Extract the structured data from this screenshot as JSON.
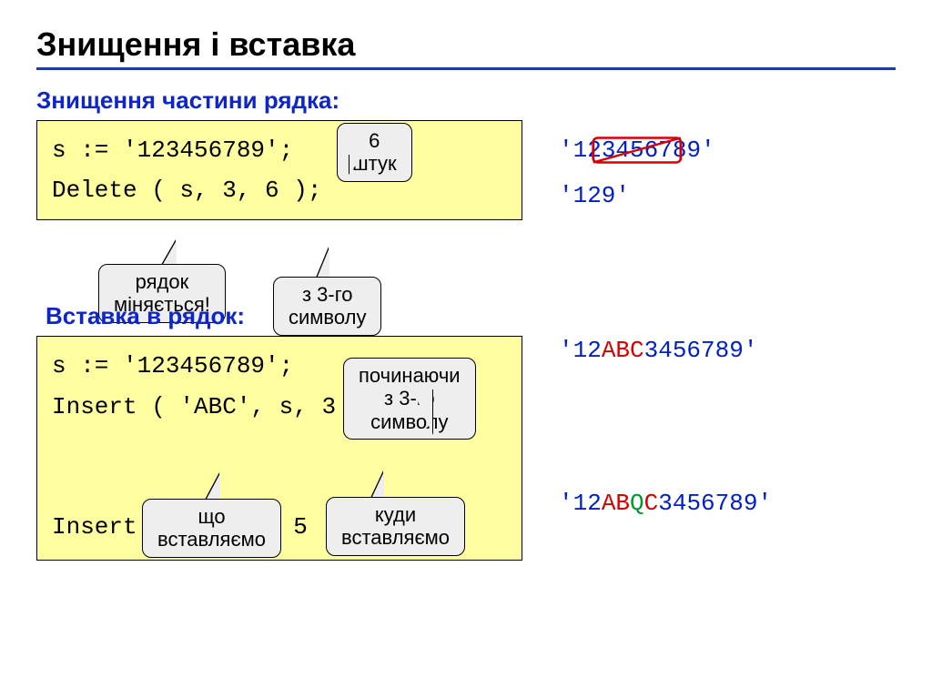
{
  "title": "Знищення і вставка",
  "section1": {
    "label": "Знищення частини рядка:",
    "code": {
      "line1": "s := '123456789';",
      "line2": "Delete ( s, 3, 6 );"
    },
    "callouts": {
      "count": "6 штук",
      "string_changes_l1": "рядок",
      "string_changes_l2": "міняється!",
      "from3": "з 3-го символу"
    },
    "results": {
      "before_pre": "'12",
      "before_mid": "345678",
      "before_post": "9'",
      "after": "'129'"
    }
  },
  "section2": {
    "label": "Вставка в рядок:",
    "code": {
      "line1": "s := '123456789';",
      "line2": "Insert ( 'ABC', s, 3 );",
      "line3": "Insert ( 'Q', s, 5 );"
    },
    "callouts": {
      "starting_from": "починаючи з 3-го символу",
      "what_l1": "що",
      "what_l2": "вставляємо",
      "where_l1": "куди",
      "where_l2": "вставляємо"
    },
    "results": {
      "r1_pre": "'12",
      "r1_ins": "ABC",
      "r1_post": "3456789'",
      "r2_pre": "'12",
      "r2_ab": "AB",
      "r2_q": "Q",
      "r2_c": "C",
      "r2_post": "3456789'"
    }
  }
}
